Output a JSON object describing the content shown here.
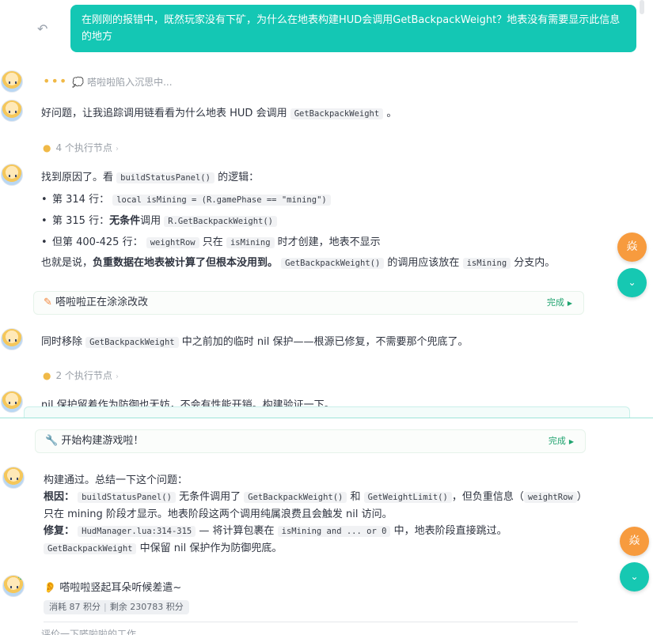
{
  "user_message": "在刚刚的报错中，既然玩家没有下矿，为什么在地表构建HUD会调用GetBackpackWeight？地表没有需要显示此信息的地方",
  "thinking_label": "嗒啦啦陷入沉思中...",
  "intro": {
    "text_before": "好问题，让我追踪调用链看看为什么地表 HUD 会调用",
    "code": "GetBackpackWeight",
    "text_after": "。"
  },
  "nodes_1": "4 个执行节点",
  "found": {
    "prefix": "找到原因了。看",
    "code": "buildStatusPanel()",
    "suffix": "的逻辑："
  },
  "bullets": {
    "b1_label": "第 314 行：",
    "b1_code": "local isMining = (R.gamePhase == \"mining\")",
    "b2_label": "第 315 行：",
    "b2_bold": "无条件",
    "b2_mid": "调用",
    "b2_code": "R.GetBackpackWeight()",
    "b3_label": "但第 400-425 行：",
    "b3_code1": "weightRow",
    "b3_mid": "只在",
    "b3_code2": "isMining",
    "b3_end": "时才创建，地表不显示"
  },
  "conclusion": {
    "prefix": "也就是说，",
    "bold": "负重数据在地表被计算了但根本没用到。",
    "code1": "GetBackpackWeight()",
    "mid": "的调用应该放在",
    "code2": "isMining",
    "end": "分支内。"
  },
  "status1": {
    "label": "嗒啦啦正在涂涂改改",
    "done": "完成"
  },
  "remove": {
    "prefix": "同时移除",
    "code": "GetBackpackWeight",
    "rest": "中之前加的临时 nil 保护——根源已修复，不需要那个兜底了。"
  },
  "nodes_2": "2 个执行节点",
  "cut_text": "nil 保护留着作为防御也无妨，不会有性能开销。构建验证一下。",
  "status2": {
    "label": "开始构建游戏啦！",
    "done": "完成"
  },
  "summary": {
    "line1": "构建通过。总结一下这个问题：",
    "root_label": "根因：",
    "root_code1": "buildStatusPanel()",
    "root_t1": "无条件调用了",
    "root_code2": "GetBackpackWeight()",
    "root_t2": "和",
    "root_code3": "GetWeightLimit()",
    "root_t3": "，但负重信息（",
    "root_code4": "weightRow",
    "root_t4": "）",
    "root_line2": "只在 mining 阶段才显示。地表阶段这两个调用纯属浪费且会触发 nil 访问。",
    "fix_label": "修复：",
    "fix_code1": "HudManager.lua:314-315",
    "fix_t1": "— 将计算包裹在",
    "fix_code2": "isMining and ... or 0",
    "fix_t2": "中，地表阶段直接跳过。",
    "fix_code3": "GetBackpackWeight",
    "fix_t3": "中保留 nil 保护作为防御兜底。"
  },
  "listening": "嗒啦啦竖起耳朵听候差遣~",
  "cost": {
    "used": "消耗 87 积分",
    "remain": "剩余 230783 积分"
  },
  "bottom_fade": "评价一下嗒啦啦的工作",
  "fab_label": "焱",
  "colors": {
    "accent": "#14c7b4",
    "orange": "#f79b3e",
    "done_green": "#1fa36f"
  }
}
